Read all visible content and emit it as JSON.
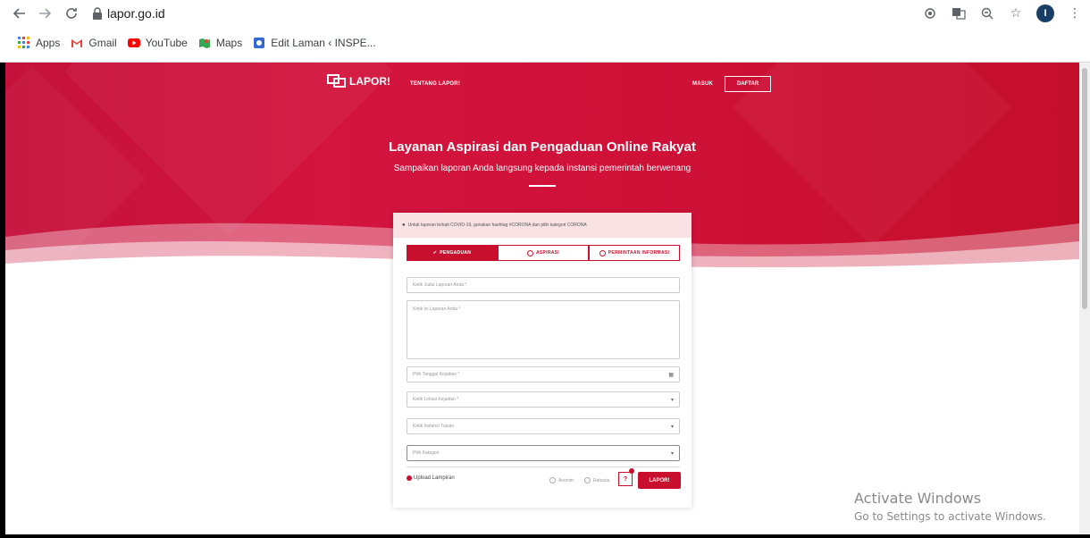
{
  "browser": {
    "url": "lapor.go.id",
    "avatar_letter": "I",
    "bookmarks": [
      {
        "label": "Apps",
        "icon": "apps-grid-icon"
      },
      {
        "label": "Gmail",
        "icon": "gmail-icon"
      },
      {
        "label": "YouTube",
        "icon": "youtube-icon"
      },
      {
        "label": "Maps",
        "icon": "maps-icon"
      },
      {
        "label": "Edit Laman ‹ INSPE...",
        "icon": "site-icon"
      }
    ]
  },
  "header": {
    "logo_text": "LAPOR!",
    "nav_about": "TENTANG LAPOR!",
    "login": "MASUK",
    "register": "DAFTAR"
  },
  "hero": {
    "title": "Layanan Aspirasi dan Pengaduan Online Rakyat",
    "subtitle": "Sampaikan laporan Anda langsung kepada instansi pemerintah berwenang"
  },
  "form": {
    "notice": "Untuk laporan terkait COVID-19, gunakan hashtag #CORONA dan pilih kategori CORONA",
    "tabs": [
      "PENGADUAN",
      "ASPIRASI",
      "PERMINTAAN INFORMASI"
    ],
    "title_placeholder": "Ketik Judul Laporan Anda *",
    "body_placeholder": "Ketik Isi Laporan Anda *",
    "date_placeholder": "Pilih Tanggal Kejadian *",
    "location_placeholder": "Ketik Lokasi Kejadian *",
    "agency_placeholder": "Ketik Instansi Tujuan",
    "category_placeholder": "Pilih Kategori",
    "upload_label": "Upload Lampiran",
    "anonymous_label": "Anonim",
    "secret_label": "Rahasia",
    "help_label": "?",
    "submit_label": "LAPOR!"
  },
  "overlay": {
    "activate_title": "Activate Windows",
    "activate_sub": "Go to Settings to activate Windows."
  },
  "colors": {
    "brand": "#c8102e",
    "hero_bg": "#d3153f"
  }
}
